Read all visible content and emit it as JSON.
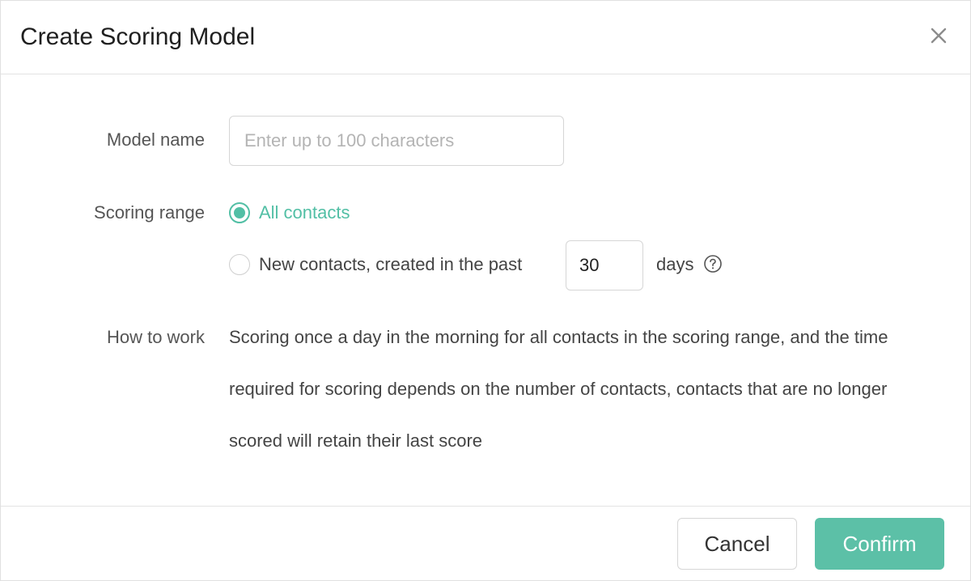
{
  "dialog": {
    "title": "Create Scoring Model"
  },
  "form": {
    "model_name": {
      "label": "Model name",
      "value": "",
      "placeholder": "Enter up to 100 characters"
    },
    "scoring_range": {
      "label": "Scoring range",
      "options": [
        {
          "label": "All contacts",
          "selected": true
        },
        {
          "label": "New contacts, created in the past",
          "selected": false
        }
      ],
      "days_value": "30",
      "days_suffix": "days"
    },
    "how_to_work": {
      "label": "How to work",
      "text": "Scoring once a day in the morning for all contacts in the scoring range, and the time required for scoring depends on the number of contacts, contacts that are no longer scored will retain their last score"
    }
  },
  "footer": {
    "cancel_label": "Cancel",
    "confirm_label": "Confirm"
  },
  "icons": {
    "close": "close-icon",
    "help": "question-circle-icon"
  },
  "colors": {
    "accent": "#52bfa5",
    "confirm_bg": "#5cc0a7"
  }
}
